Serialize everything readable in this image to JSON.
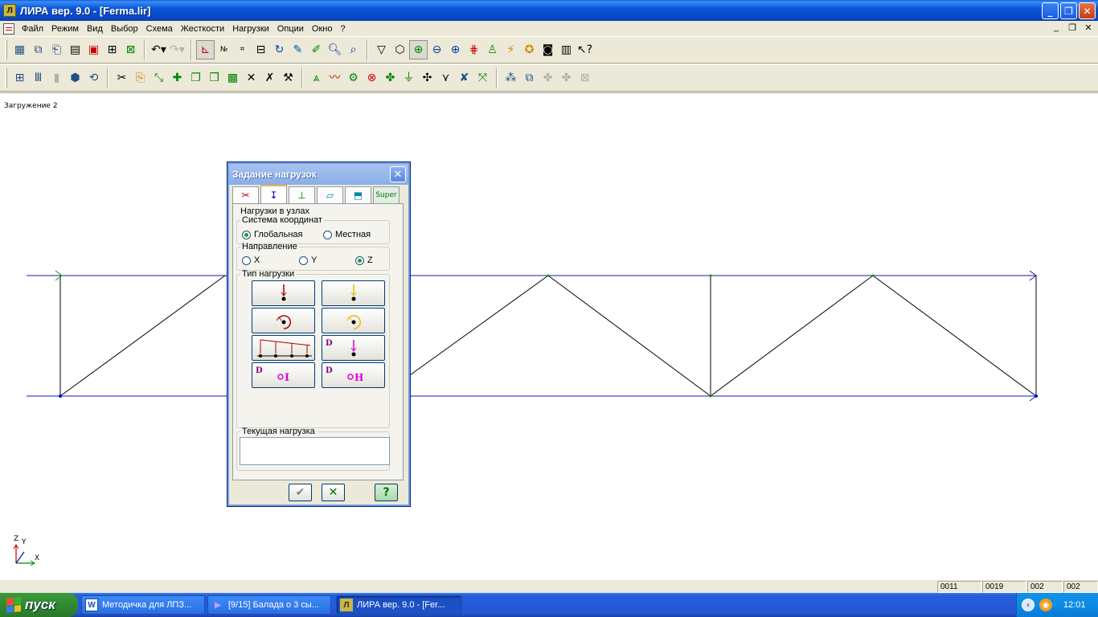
{
  "window": {
    "title": "ЛИРА  вер. 9.0 - [Ferma.lir]",
    "minimize": "_",
    "maximize": "❐",
    "close": "✕"
  },
  "menu": {
    "items": [
      "Файл",
      "Режим",
      "Вид",
      "Выбор",
      "Схема",
      "Жесткости",
      "Нагрузки",
      "Опции",
      "Окно",
      "?"
    ],
    "mdi_minimize": "_",
    "mdi_restore": "❐",
    "mdi_close": "✕"
  },
  "toolbar1": {
    "icons": [
      "new-icon",
      "open-icon",
      "save-icon",
      "print-icon",
      "print-preview-icon",
      "export-icon",
      "import-icon",
      "undo-icon",
      "redo-icon",
      "axes-3d-icon",
      "node-numbers-icon",
      "element-numbers-icon",
      "grid-icon",
      "rotate-icon",
      "edit-icon",
      "pencil-icon",
      "zoom-in-icon",
      "zoom-out-icon",
      "filter-icon",
      "fragment-icon",
      "zoom-window-icon",
      "zoom-minus-icon",
      "zoom-plus-icon",
      "mesh-icon",
      "person-icon",
      "load-scheme-icon",
      "run-icon",
      "camera-icon",
      "report-icon",
      "help-pointer-icon"
    ]
  },
  "toolbar2": {
    "icons": [
      "frame-icon",
      "columns-icon",
      "cylinder-icon",
      "cube-icon",
      "rotate-cube-icon",
      "cut-icon",
      "paste-icon",
      "move-icon",
      "add-node-icon",
      "copy-icon",
      "copy2-icon",
      "group-icon",
      "select-icon",
      "tool-icon",
      "supports-icon",
      "hinges-icon",
      "stiffness-icon",
      "loads-icon",
      "mass-icon",
      "mirror-icon",
      "cross-icon",
      "branch-icon",
      "delete-icon",
      "marker-icon",
      "clusters-icon",
      "view-icon",
      "grey1-icon",
      "grey2-icon",
      "grey3-icon"
    ]
  },
  "workarea": {
    "load_caption": "Загружение  2"
  },
  "dialog": {
    "title": "Задание  нагрузок",
    "close": "✕",
    "tabs": [
      "scissors-tab-icon",
      "node-load-tab-icon",
      "element-load-tab-icon",
      "plate-load-tab-icon",
      "solid-load-tab-icon",
      "Super"
    ],
    "panel_caption": "Нагрузки в узлах",
    "coord_system": {
      "legend": "Система координат",
      "global": "Глобальная",
      "local": "Местная",
      "selected": "global"
    },
    "direction": {
      "legend": "Направление",
      "x": "X",
      "y": "Y",
      "z": "Z",
      "selected": "z"
    },
    "load_type": {
      "legend": "Тип нагрузки",
      "buttons": [
        "force-node-icon",
        "force-yellow-icon",
        "moment-node-icon",
        "moment-yellow-icon",
        "distributed-node-icon",
        "dynamic-force-icon",
        "dynamic-I-icon",
        "dynamic-H-icon"
      ],
      "d_label": "D",
      "i_label": "I",
      "h_label": "H"
    },
    "current_load": {
      "legend": "Текущая нагрузка",
      "value": ""
    },
    "footer": {
      "apply": "✔",
      "cancel": "✕",
      "help": "?"
    }
  },
  "axes": {
    "z": "Z",
    "y": "Y",
    "x": "X"
  },
  "statusbar": {
    "cells": [
      "0011",
      "0019",
      "002",
      "002"
    ]
  },
  "taskbar": {
    "start": "пуск",
    "tasks": [
      {
        "label": "Методичка для ЛПЗ...",
        "icon": "W"
      },
      {
        "label": "[9/15] Балада о 3 сы...",
        "icon": "▶"
      },
      {
        "label": "ЛИРА  вер. 9.0 - [Fer...",
        "icon": "Л"
      }
    ],
    "clock": "12:01"
  },
  "colors": {
    "title_blue": "#0a56d8",
    "truss_line": "#000000",
    "chord_line": "#1a1aa0",
    "node_green": "#00a000",
    "node_blue": "#0000ff"
  }
}
